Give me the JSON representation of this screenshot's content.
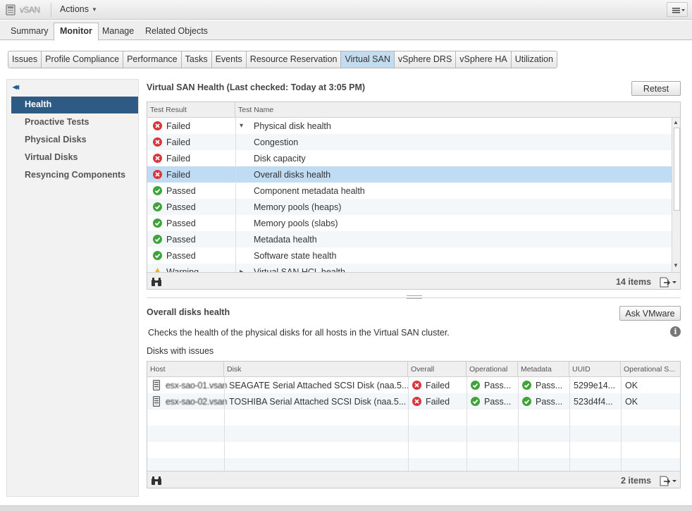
{
  "topbar": {
    "object_name": "vSAN",
    "actions_label": "Actions"
  },
  "main_tabs": [
    {
      "label": "Summary"
    },
    {
      "label": "Monitor"
    },
    {
      "label": "Manage"
    },
    {
      "label": "Related Objects"
    }
  ],
  "sub_tabs": [
    {
      "label": "Issues"
    },
    {
      "label": "Profile Compliance"
    },
    {
      "label": "Performance"
    },
    {
      "label": "Tasks"
    },
    {
      "label": "Events"
    },
    {
      "label": "Resource Reservation"
    },
    {
      "label": "Virtual SAN"
    },
    {
      "label": "vSphere DRS"
    },
    {
      "label": "vSphere HA"
    },
    {
      "label": "Utilization"
    }
  ],
  "left_nav": {
    "collapse_glyph": "◂◂",
    "items": [
      {
        "label": "Health"
      },
      {
        "label": "Proactive Tests"
      },
      {
        "label": "Physical Disks"
      },
      {
        "label": "Virtual Disks"
      },
      {
        "label": "Resyncing Components"
      }
    ]
  },
  "health": {
    "title": "Virtual SAN Health (Last checked: Today at 3:05 PM)",
    "retest_label": "Retest",
    "columns": [
      "Test Result",
      "Test Name"
    ],
    "rows": [
      {
        "result": "Failed",
        "status": "fail",
        "name": "Physical disk health",
        "expand": "▾"
      },
      {
        "result": "Failed",
        "status": "fail",
        "name": "Congestion"
      },
      {
        "result": "Failed",
        "status": "fail",
        "name": "Disk capacity"
      },
      {
        "result": "Failed",
        "status": "fail",
        "name": "Overall disks health"
      },
      {
        "result": "Passed",
        "status": "pass",
        "name": "Component metadata health"
      },
      {
        "result": "Passed",
        "status": "pass",
        "name": "Memory pools (heaps)"
      },
      {
        "result": "Passed",
        "status": "pass",
        "name": "Memory pools (slabs)"
      },
      {
        "result": "Passed",
        "status": "pass",
        "name": "Metadata health"
      },
      {
        "result": "Passed",
        "status": "pass",
        "name": "Software state health"
      },
      {
        "result": "Warning",
        "status": "warn",
        "name": "Virtual SAN HCL health",
        "expand": "▸"
      }
    ],
    "item_count": "14 items"
  },
  "detail": {
    "title": "Overall disks health",
    "ask_label": "Ask VMware",
    "description": "Checks the health of the physical disks for all hosts in the Virtual SAN cluster.",
    "subheading": "Disks with issues",
    "columns": [
      "Host",
      "Disk",
      "Overall",
      "Operational",
      "Metadata",
      "UUID",
      "Operational S..."
    ],
    "rows": [
      {
        "host": "esx-sao-01.vsan",
        "disk": "SEAGATE Serial Attached SCSI Disk (naa.5...",
        "overall": "Failed",
        "operational": "Pass...",
        "metadata": "Pass...",
        "uuid": "5299e14...",
        "op_state": "OK"
      },
      {
        "host": "esx-sao-02.vsan",
        "disk": "TOSHIBA Serial Attached SCSI Disk (naa.5...",
        "overall": "Failed",
        "operational": "Pass...",
        "metadata": "Pass...",
        "uuid": "523d4f4...",
        "op_state": "OK"
      }
    ],
    "item_count": "2 items"
  },
  "colors": {
    "accent": "#2e5b86",
    "selected_tab": "#c4dcef",
    "selected_row": "#bfdcf4",
    "fail": "#d9363e",
    "pass": "#3fa33a"
  }
}
